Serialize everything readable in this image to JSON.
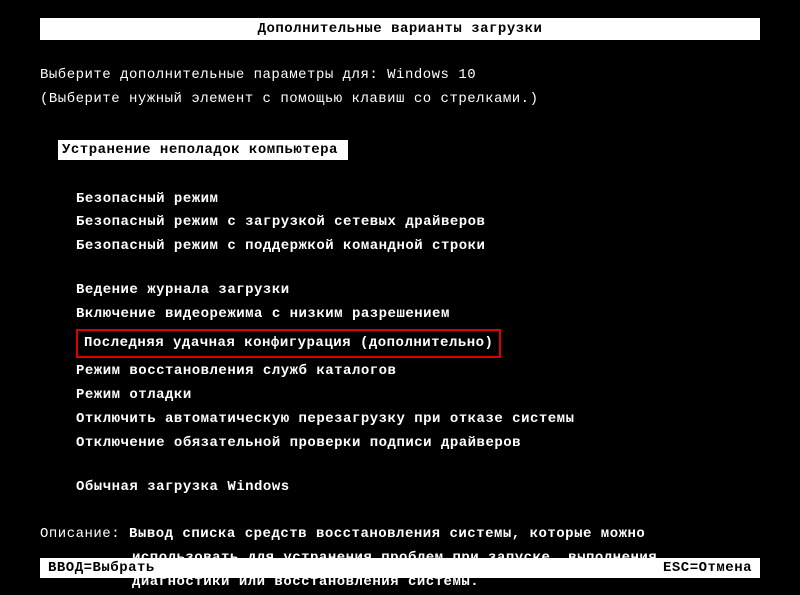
{
  "title": "Дополнительные варианты загрузки",
  "instruction_line1": "Выберите дополнительные параметры для: Windows 10",
  "instruction_line2": "(Выберите нужный элемент с помощью клавиш со стрелками.)",
  "section_header": "Устранение неполадок компьютера",
  "menu": {
    "group1": [
      "Безопасный режим",
      "Безопасный режим с загрузкой сетевых драйверов",
      "Безопасный режим с поддержкой командной строки"
    ],
    "group2": [
      "Ведение журнала загрузки",
      "Включение видеорежима с низким разрешением",
      "Последняя удачная конфигурация (дополнительно)",
      "Режим восстановления служб каталогов",
      "Режим отладки",
      "Отключить автоматическую перезагрузку при отказе системы",
      "Отключение обязательной проверки подписи драйверов"
    ],
    "group3": [
      "Обычная загрузка Windows"
    ]
  },
  "highlighted_index": 2,
  "description": {
    "label": "Описание: ",
    "line1": "Вывод списка средств восстановления системы, которые можно",
    "line2": "использовать для устранения проблем при запуске, выполнения",
    "line3": "диагностики или восстановления системы."
  },
  "footer": {
    "left": "ВВОД=Выбрать",
    "right": "ESC=Отмена"
  }
}
